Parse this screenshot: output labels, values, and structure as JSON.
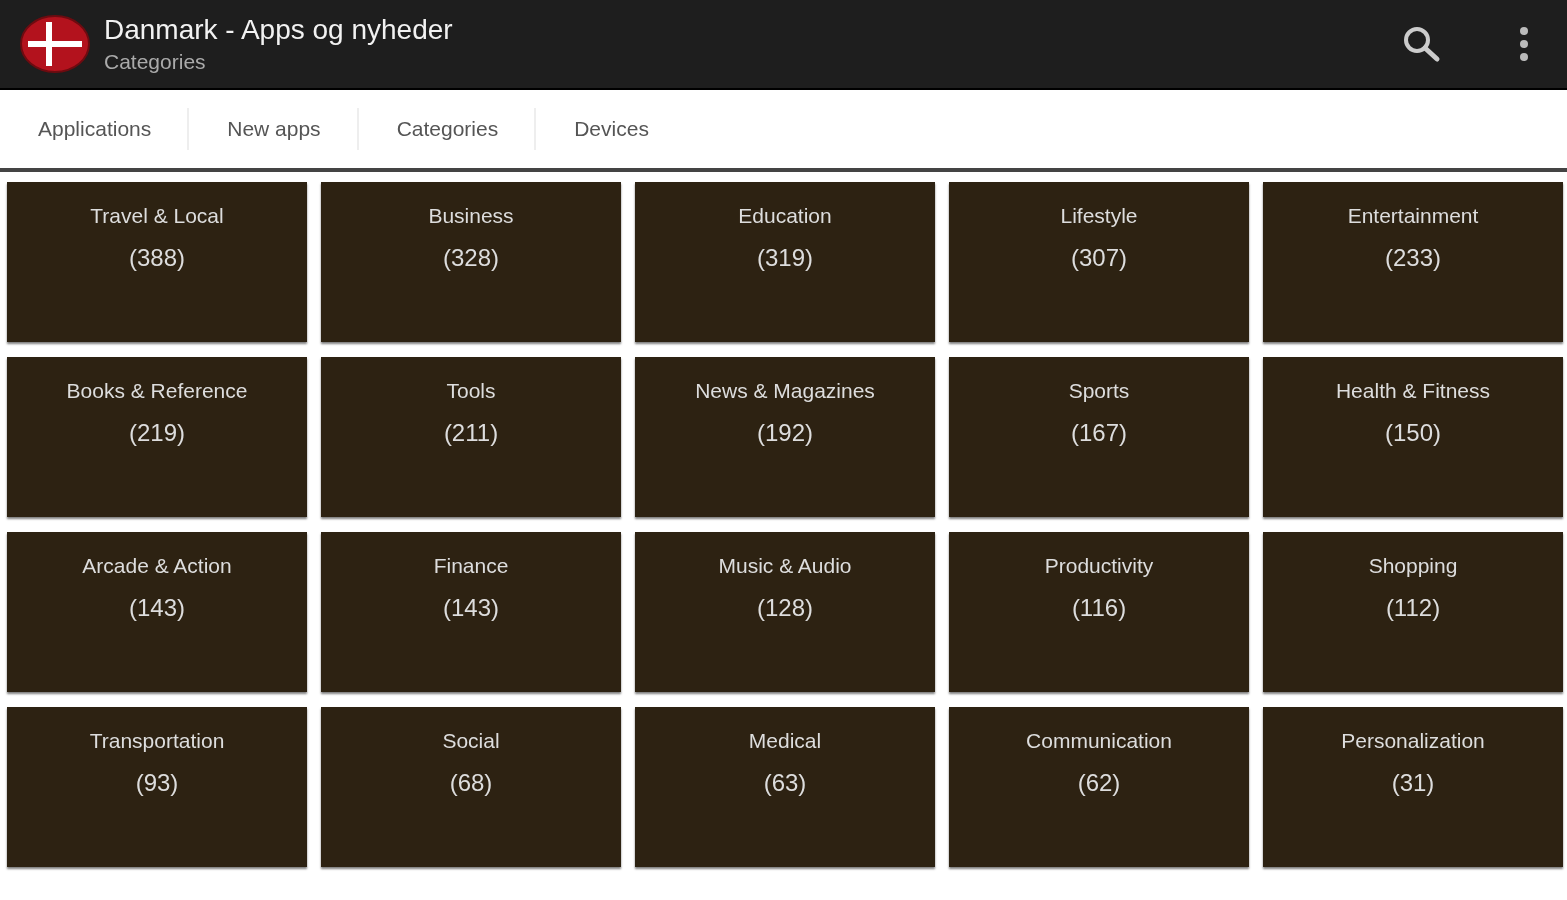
{
  "header": {
    "title": "Danmark - Apps og nyheder",
    "subtitle": "Categories"
  },
  "tabs": [
    {
      "label": "Applications"
    },
    {
      "label": "New apps"
    },
    {
      "label": "Categories"
    },
    {
      "label": "Devices"
    }
  ],
  "categories": [
    {
      "name": "Travel & Local",
      "count": "(388)"
    },
    {
      "name": "Business",
      "count": "(328)"
    },
    {
      "name": "Education",
      "count": "(319)"
    },
    {
      "name": "Lifestyle",
      "count": "(307)"
    },
    {
      "name": "Entertainment",
      "count": "(233)"
    },
    {
      "name": "Books & Reference",
      "count": "(219)"
    },
    {
      "name": "Tools",
      "count": "(211)"
    },
    {
      "name": "News & Magazines",
      "count": "(192)"
    },
    {
      "name": "Sports",
      "count": "(167)"
    },
    {
      "name": "Health & Fitness",
      "count": "(150)"
    },
    {
      "name": "Arcade & Action",
      "count": "(143)"
    },
    {
      "name": "Finance",
      "count": "(143)"
    },
    {
      "name": "Music & Audio",
      "count": "(128)"
    },
    {
      "name": "Productivity",
      "count": "(116)"
    },
    {
      "name": "Shopping",
      "count": "(112)"
    },
    {
      "name": "Transportation",
      "count": "(93)"
    },
    {
      "name": "Social",
      "count": "(68)"
    },
    {
      "name": "Medical",
      "count": "(63)"
    },
    {
      "name": "Communication",
      "count": "(62)"
    },
    {
      "name": "Personalization",
      "count": "(31)"
    }
  ]
}
